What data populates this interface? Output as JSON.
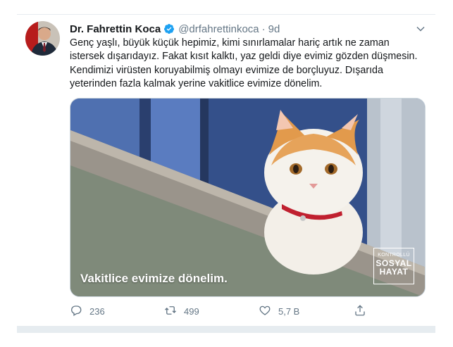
{
  "tweet": {
    "display_name": "Dr. Fahrettin Koca",
    "handle": "@drfahrettinkoca",
    "separator": "·",
    "time": "9d",
    "lines": [
      "Genç yaşlı, büyük küçük hepimiz, kimi sınırlamalar hariç artık ne zaman",
      "istersek dışarıdayız. Fakat kısıt kalktı, yaz geldi diye evimiz gözden düşmesin.",
      "Kendimizi virüsten koruyabilmiş olmayı evimize de borçluyuz. Dışarıda",
      "yeterinden fazla kalmak yerine vakitlice evimize dönelim."
    ]
  },
  "media": {
    "caption": "Vakitlice evimize dönelim.",
    "badge": {
      "line1": "KONTROLLÜ",
      "line2": "SOSYAL",
      "line3": "HAYAT"
    }
  },
  "actions": {
    "replies": "236",
    "retweets": "499",
    "likes": "5,7 B"
  },
  "icons": {
    "verified": "verified-badge-icon",
    "caret": "chevron-down-icon",
    "reply": "reply-icon",
    "retweet": "retweet-icon",
    "like": "heart-icon",
    "share": "share-icon"
  },
  "colors": {
    "verified": "#1da1f2",
    "muted": "#657786",
    "text": "#14171a",
    "border": "#e6ecf0"
  }
}
